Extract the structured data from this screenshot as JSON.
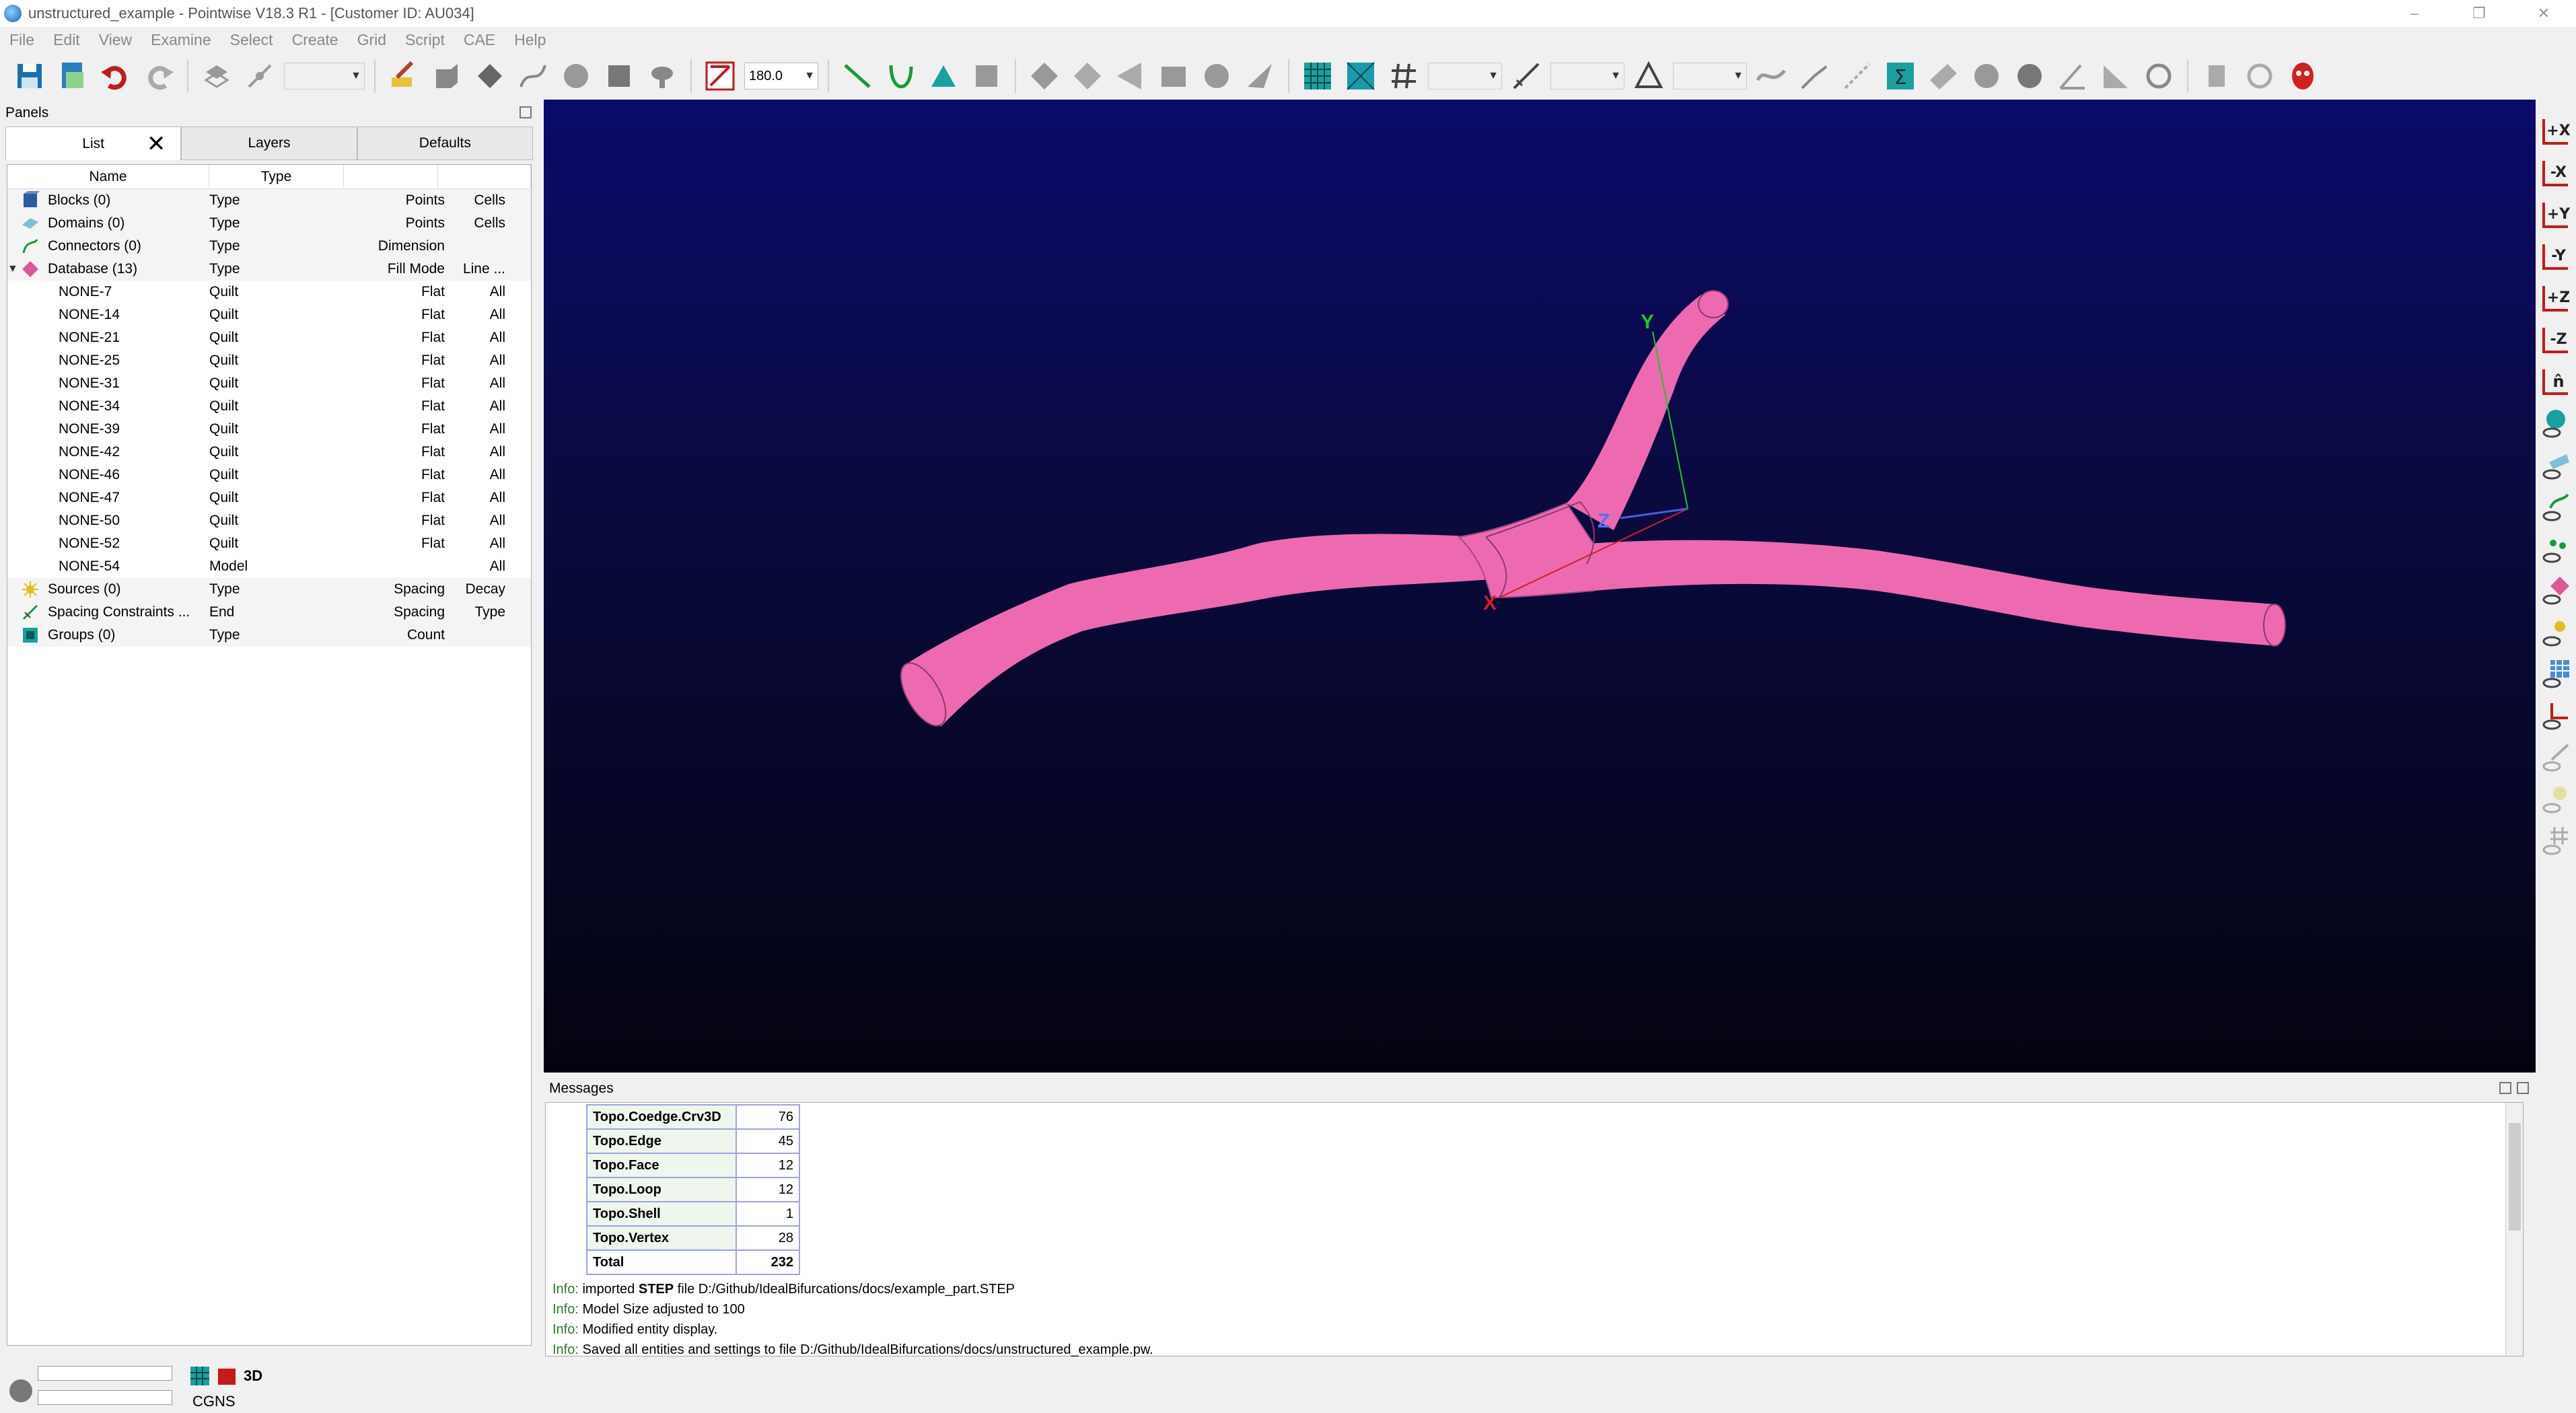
{
  "window": {
    "title": "unstructured_example - Pointwise V18.3 R1 - [Customer ID: AU034]",
    "controls": [
      "–",
      "❐",
      "✕"
    ]
  },
  "menu": [
    "File",
    "Edit",
    "View",
    "Examine",
    "Select",
    "Create",
    "Grid",
    "Script",
    "CAE",
    "Help"
  ],
  "toolbar": {
    "angle_value": "180.0"
  },
  "panels": {
    "title": "Panels",
    "tabs": [
      "List",
      "Layers",
      "Defaults"
    ],
    "columns": [
      "Name",
      "Type"
    ],
    "categories": [
      {
        "name": "Blocks (0)",
        "type": "Type",
        "a": "Points",
        "b": "Cells"
      },
      {
        "name": "Domains (0)",
        "type": "Type",
        "a": "Points",
        "b": "Cells"
      },
      {
        "name": "Connectors (0)",
        "type": "Type",
        "a": "Dimension",
        "b": ""
      },
      {
        "name": "Database (13)",
        "type": "Type",
        "a": "Fill Mode",
        "b": "Line ..."
      }
    ],
    "database_items": [
      {
        "name": "NONE-7",
        "type": "Quilt",
        "fill": "Flat",
        "line": "All"
      },
      {
        "name": "NONE-14",
        "type": "Quilt",
        "fill": "Flat",
        "line": "All"
      },
      {
        "name": "NONE-21",
        "type": "Quilt",
        "fill": "Flat",
        "line": "All"
      },
      {
        "name": "NONE-25",
        "type": "Quilt",
        "fill": "Flat",
        "line": "All"
      },
      {
        "name": "NONE-31",
        "type": "Quilt",
        "fill": "Flat",
        "line": "All"
      },
      {
        "name": "NONE-34",
        "type": "Quilt",
        "fill": "Flat",
        "line": "All"
      },
      {
        "name": "NONE-39",
        "type": "Quilt",
        "fill": "Flat",
        "line": "All"
      },
      {
        "name": "NONE-42",
        "type": "Quilt",
        "fill": "Flat",
        "line": "All"
      },
      {
        "name": "NONE-46",
        "type": "Quilt",
        "fill": "Flat",
        "line": "All"
      },
      {
        "name": "NONE-47",
        "type": "Quilt",
        "fill": "Flat",
        "line": "All"
      },
      {
        "name": "NONE-50",
        "type": "Quilt",
        "fill": "Flat",
        "line": "All"
      },
      {
        "name": "NONE-52",
        "type": "Quilt",
        "fill": "Flat",
        "line": "All"
      },
      {
        "name": "NONE-54",
        "type": "Model",
        "fill": "",
        "line": "All"
      }
    ],
    "tail_categories": [
      {
        "name": "Sources (0)",
        "type": "Type",
        "a": "Spacing",
        "b": "Decay"
      },
      {
        "name": "Spacing Constraints ...",
        "type": "End",
        "a": "Spacing",
        "b": "Type"
      },
      {
        "name": "Groups (0)",
        "type": "Type",
        "a": "Count",
        "b": ""
      }
    ]
  },
  "viewport": {
    "axis_labels": {
      "x": "X",
      "y": "Y",
      "z": "Z"
    },
    "model_color": "#ee6ab0"
  },
  "messages": {
    "title": "Messages",
    "table": [
      {
        "label": "Topo.Coedge.Crv3D",
        "value": "76"
      },
      {
        "label": "Topo.Edge",
        "value": "45"
      },
      {
        "label": "Topo.Face",
        "value": "12"
      },
      {
        "label": "Topo.Loop",
        "value": "12"
      },
      {
        "label": "Topo.Shell",
        "value": "1"
      },
      {
        "label": "Topo.Vertex",
        "value": "28"
      },
      {
        "label": "Total",
        "value": "232"
      }
    ],
    "lines": [
      {
        "prefix": "Info:",
        "pre": " imported ",
        "bold": "STEP",
        "post": " file D:/Github/IdealBifurcations/docs/example_part.STEP"
      },
      {
        "prefix": "Info:",
        "pre": " Model Size adjusted to 100",
        "bold": "",
        "post": ""
      },
      {
        "prefix": "Info:",
        "pre": " Modified entity display.",
        "bold": "",
        "post": ""
      },
      {
        "prefix": "Info:",
        "pre": " Saved all entities and settings to file D:/Github/IdealBifurcations/docs/unstructured_example.pw.",
        "bold": "",
        "post": ""
      }
    ]
  },
  "status": {
    "solver": "CGNS",
    "view_mode": "3D"
  }
}
